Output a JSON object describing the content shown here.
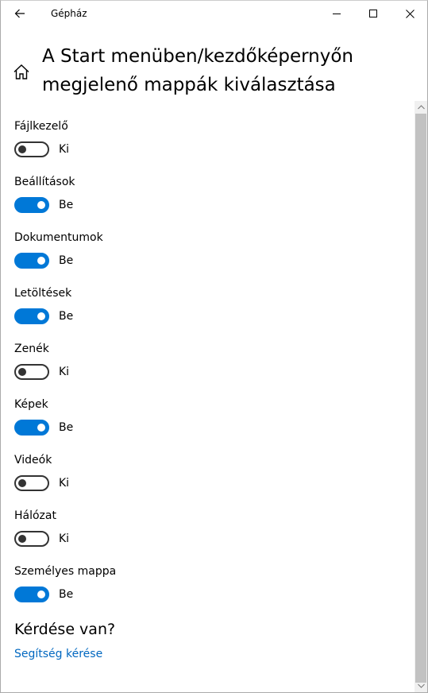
{
  "window": {
    "title": "Gépház"
  },
  "page": {
    "title": "A Start menüben/kezdőképernyőn megjelenő mappák kiválasztása"
  },
  "settings": [
    {
      "label": "Fájlkezelő",
      "on": false,
      "state": "Ki"
    },
    {
      "label": "Beállítások",
      "on": true,
      "state": "Be"
    },
    {
      "label": "Dokumentumok",
      "on": true,
      "state": "Be"
    },
    {
      "label": "Letöltések",
      "on": true,
      "state": "Be"
    },
    {
      "label": "Zenék",
      "on": false,
      "state": "Ki"
    },
    {
      "label": "Képek",
      "on": true,
      "state": "Be"
    },
    {
      "label": "Videók",
      "on": false,
      "state": "Ki"
    },
    {
      "label": "Hálózat",
      "on": false,
      "state": "Ki"
    },
    {
      "label": "Személyes mappa",
      "on": true,
      "state": "Be"
    }
  ],
  "help": {
    "heading": "Kérdése van?",
    "link": "Segítség kérése"
  },
  "colors": {
    "accent": "#0078d7",
    "link": "#0067c0"
  }
}
